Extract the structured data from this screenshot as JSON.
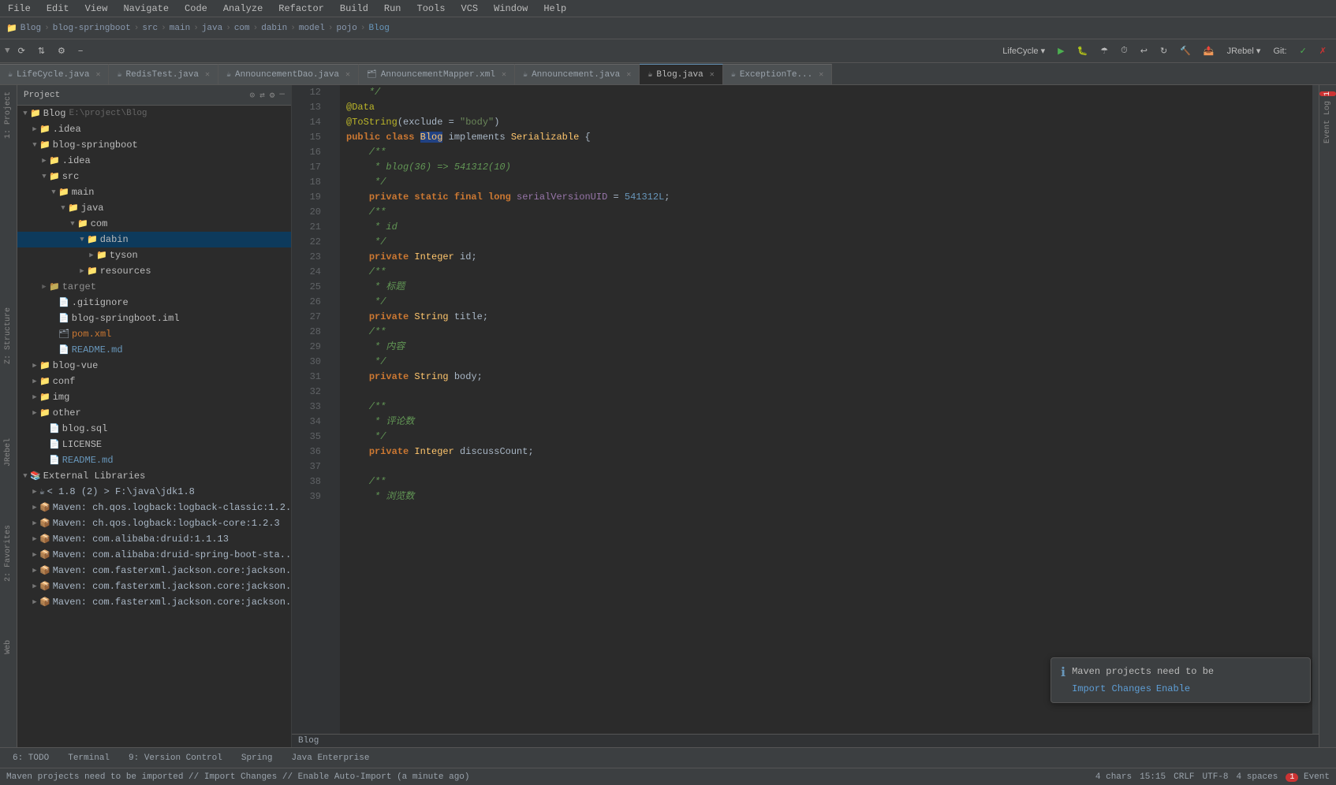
{
  "menu": {
    "items": [
      "File",
      "Edit",
      "View",
      "Navigate",
      "Code",
      "Analyze",
      "Refactor",
      "Build",
      "Run",
      "Tools",
      "VCS",
      "Window",
      "Help"
    ]
  },
  "breadcrumb": {
    "items": [
      "Blog",
      "blog-springboot",
      "src",
      "main",
      "java",
      "com",
      "dabin",
      "model",
      "pojo",
      "Blog"
    ]
  },
  "toolbar": {
    "lifecycle_label": "LifeCycle",
    "jrebel_label": "JRebel",
    "git_label": "Git:"
  },
  "tabs": [
    {
      "label": "LifeCycle.java",
      "icon": "☕",
      "modified": false
    },
    {
      "label": "RedisTest.java",
      "icon": "☕",
      "modified": false
    },
    {
      "label": "AnnouncementDao.java",
      "icon": "☕",
      "modified": false
    },
    {
      "label": "AnnouncementMapper.xml",
      "icon": "🗂",
      "modified": false
    },
    {
      "label": "Announcement.java",
      "icon": "☕",
      "modified": false
    },
    {
      "label": "Blog.java",
      "icon": "☕",
      "modified": false,
      "active": true
    },
    {
      "label": "ExceptionTe...",
      "icon": "☕",
      "modified": false
    }
  ],
  "project_panel": {
    "title": "Project",
    "tree": [
      {
        "level": 0,
        "type": "root",
        "label": "Blog",
        "sub": "E:\\project\\Blog",
        "expanded": true,
        "icon": "📁"
      },
      {
        "level": 1,
        "type": "folder",
        "label": ".idea",
        "expanded": false,
        "icon": "📁"
      },
      {
        "level": 1,
        "type": "folder",
        "label": "blog-springboot",
        "expanded": true,
        "icon": "📁"
      },
      {
        "level": 2,
        "type": "folder",
        "label": ".idea",
        "expanded": false,
        "icon": "📁"
      },
      {
        "level": 2,
        "type": "folder",
        "label": "src",
        "expanded": true,
        "icon": "📁"
      },
      {
        "level": 3,
        "type": "folder",
        "label": "main",
        "expanded": true,
        "icon": "📁"
      },
      {
        "level": 4,
        "type": "folder",
        "label": "java",
        "expanded": true,
        "icon": "📁"
      },
      {
        "level": 5,
        "type": "folder",
        "label": "com",
        "expanded": true,
        "icon": "📁"
      },
      {
        "level": 6,
        "type": "folder",
        "label": "dabin",
        "expanded": true,
        "icon": "📁",
        "selected": true
      },
      {
        "level": 7,
        "type": "folder",
        "label": "tyson",
        "expanded": false,
        "icon": "📁"
      },
      {
        "level": 6,
        "type": "folder",
        "label": "resources",
        "expanded": false,
        "icon": "📁"
      },
      {
        "level": 2,
        "type": "folder",
        "label": "target",
        "expanded": false,
        "icon": "📁"
      },
      {
        "level": 2,
        "type": "file",
        "label": ".gitignore",
        "icon": "📄"
      },
      {
        "level": 2,
        "type": "file",
        "label": "blog-springboot.iml",
        "icon": "📄",
        "color": "iml"
      },
      {
        "level": 2,
        "type": "file",
        "label": "pom.xml",
        "icon": "🗂",
        "color": "pom"
      },
      {
        "level": 2,
        "type": "file",
        "label": "README.md",
        "icon": "📄",
        "color": "md"
      },
      {
        "level": 1,
        "type": "folder",
        "label": "blog-vue",
        "expanded": false,
        "icon": "📁"
      },
      {
        "level": 1,
        "type": "folder",
        "label": "conf",
        "expanded": false,
        "icon": "📁"
      },
      {
        "level": 1,
        "type": "folder",
        "label": "img",
        "expanded": false,
        "icon": "📁"
      },
      {
        "level": 1,
        "type": "folder",
        "label": "other",
        "expanded": false,
        "icon": "📁"
      },
      {
        "level": 1,
        "type": "file",
        "label": "blog.sql",
        "icon": "📄",
        "color": "sql"
      },
      {
        "level": 1,
        "type": "file",
        "label": "LICENSE",
        "icon": "📄"
      },
      {
        "level": 1,
        "type": "file",
        "label": "README.md",
        "icon": "📄",
        "color": "md"
      },
      {
        "level": 0,
        "type": "folder",
        "label": "External Libraries",
        "expanded": true,
        "icon": "📚"
      },
      {
        "level": 1,
        "type": "lib",
        "label": "< 1.8 (2) > F:\\java\\jdk1.8",
        "icon": "☕"
      },
      {
        "level": 1,
        "type": "lib",
        "label": "Maven: ch.qos.logback:logback-classic:1.2...",
        "icon": "📦"
      },
      {
        "level": 1,
        "type": "lib",
        "label": "Maven: ch.qos.logback:logback-core:1.2.3",
        "icon": "📦"
      },
      {
        "level": 1,
        "type": "lib",
        "label": "Maven: com.alibaba:druid:1.1.13",
        "icon": "📦"
      },
      {
        "level": 1,
        "type": "lib",
        "label": "Maven: com.alibaba:druid-spring-boot-sta...",
        "icon": "📦"
      },
      {
        "level": 1,
        "type": "lib",
        "label": "Maven: com.fasterxml.jackson.core:jackson...",
        "icon": "📦"
      },
      {
        "level": 1,
        "type": "lib",
        "label": "Maven: com.fasterxml.jackson.core:jackson...",
        "icon": "📦"
      },
      {
        "level": 1,
        "type": "lib",
        "label": "Maven: com.fasterxml.jackson.core:jackson...",
        "icon": "📦"
      }
    ]
  },
  "code": {
    "filename": "Blog",
    "lines": [
      {
        "num": 12,
        "content": "    */"
      },
      {
        "num": 13,
        "content": "@Data"
      },
      {
        "num": 14,
        "content": "@ToString(exclude = \"body\")"
      },
      {
        "num": 15,
        "content": "public class Blog implements Serializable {"
      },
      {
        "num": 16,
        "content": "    /**"
      },
      {
        "num": 17,
        "content": "     * blog(36) => 541312(10)"
      },
      {
        "num": 18,
        "content": "     */"
      },
      {
        "num": 19,
        "content": "    private static final long serialVersionUID = 541312L;"
      },
      {
        "num": 20,
        "content": "    /**"
      },
      {
        "num": 21,
        "content": "     * id"
      },
      {
        "num": 22,
        "content": "     */"
      },
      {
        "num": 23,
        "content": "    private Integer id;"
      },
      {
        "num": 24,
        "content": "    /**"
      },
      {
        "num": 25,
        "content": "     * 标题"
      },
      {
        "num": 26,
        "content": "     */"
      },
      {
        "num": 27,
        "content": "    private String title;"
      },
      {
        "num": 28,
        "content": "    /**"
      },
      {
        "num": 29,
        "content": "     * 内容"
      },
      {
        "num": 30,
        "content": "     */"
      },
      {
        "num": 31,
        "content": "    private String body;"
      },
      {
        "num": 32,
        "content": ""
      },
      {
        "num": 33,
        "content": "    /**"
      },
      {
        "num": 34,
        "content": "     * 评论数"
      },
      {
        "num": 35,
        "content": "     */"
      },
      {
        "num": 36,
        "content": "    private Integer discussCount;"
      },
      {
        "num": 37,
        "content": ""
      },
      {
        "num": 38,
        "content": "    /**"
      },
      {
        "num": 39,
        "content": "     * 浏览数"
      }
    ]
  },
  "bottom_tabs": [
    {
      "label": "6: TODO"
    },
    {
      "label": "Terminal"
    },
    {
      "label": "9: Version Control"
    },
    {
      "label": "Spring"
    },
    {
      "label": "Java Enterprise"
    }
  ],
  "status_bar": {
    "message": "Maven projects need to be imported // Import Changes // Enable Auto-Import (a minute ago)",
    "position": "15:15",
    "line_ending": "CRLF",
    "encoding": "UTF-8",
    "indent": "4 spaces"
  },
  "notification": {
    "text": "Maven projects need to be",
    "import_link": "Import Changes",
    "enable_link": "Enable"
  },
  "event_log_badge": "1"
}
